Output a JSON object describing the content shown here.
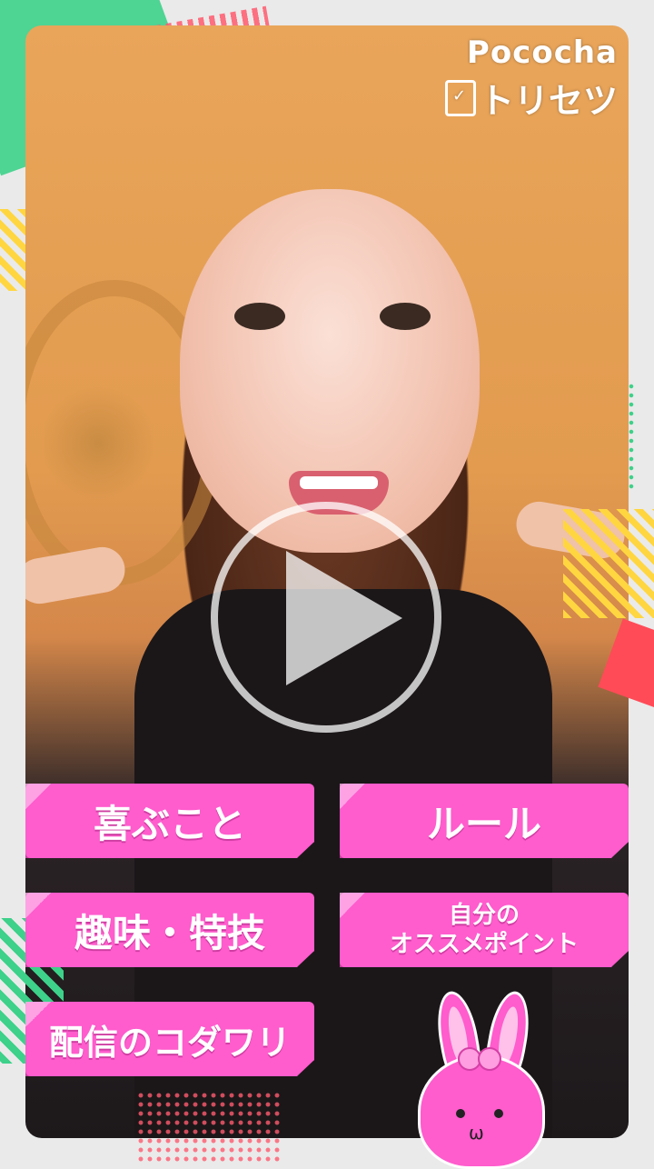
{
  "logo": {
    "brand": "Pococha",
    "subtitle": "トリセツ"
  },
  "buttons": [
    {
      "label": "喜ぶこと"
    },
    {
      "label": "ルール"
    },
    {
      "label": "趣味・特技"
    },
    {
      "line1": "自分の",
      "line2": "オススメポイント"
    },
    {
      "label": "配信のコダワリ"
    }
  ],
  "colors": {
    "button": "#ff5ccd",
    "accent_green": "#3dd18a",
    "accent_red": "#ff5a6e",
    "accent_yellow": "#ffd640"
  },
  "icons": {
    "play": "play-icon",
    "book": "book-check-icon",
    "mascot": "pink-bunny-mascot"
  }
}
